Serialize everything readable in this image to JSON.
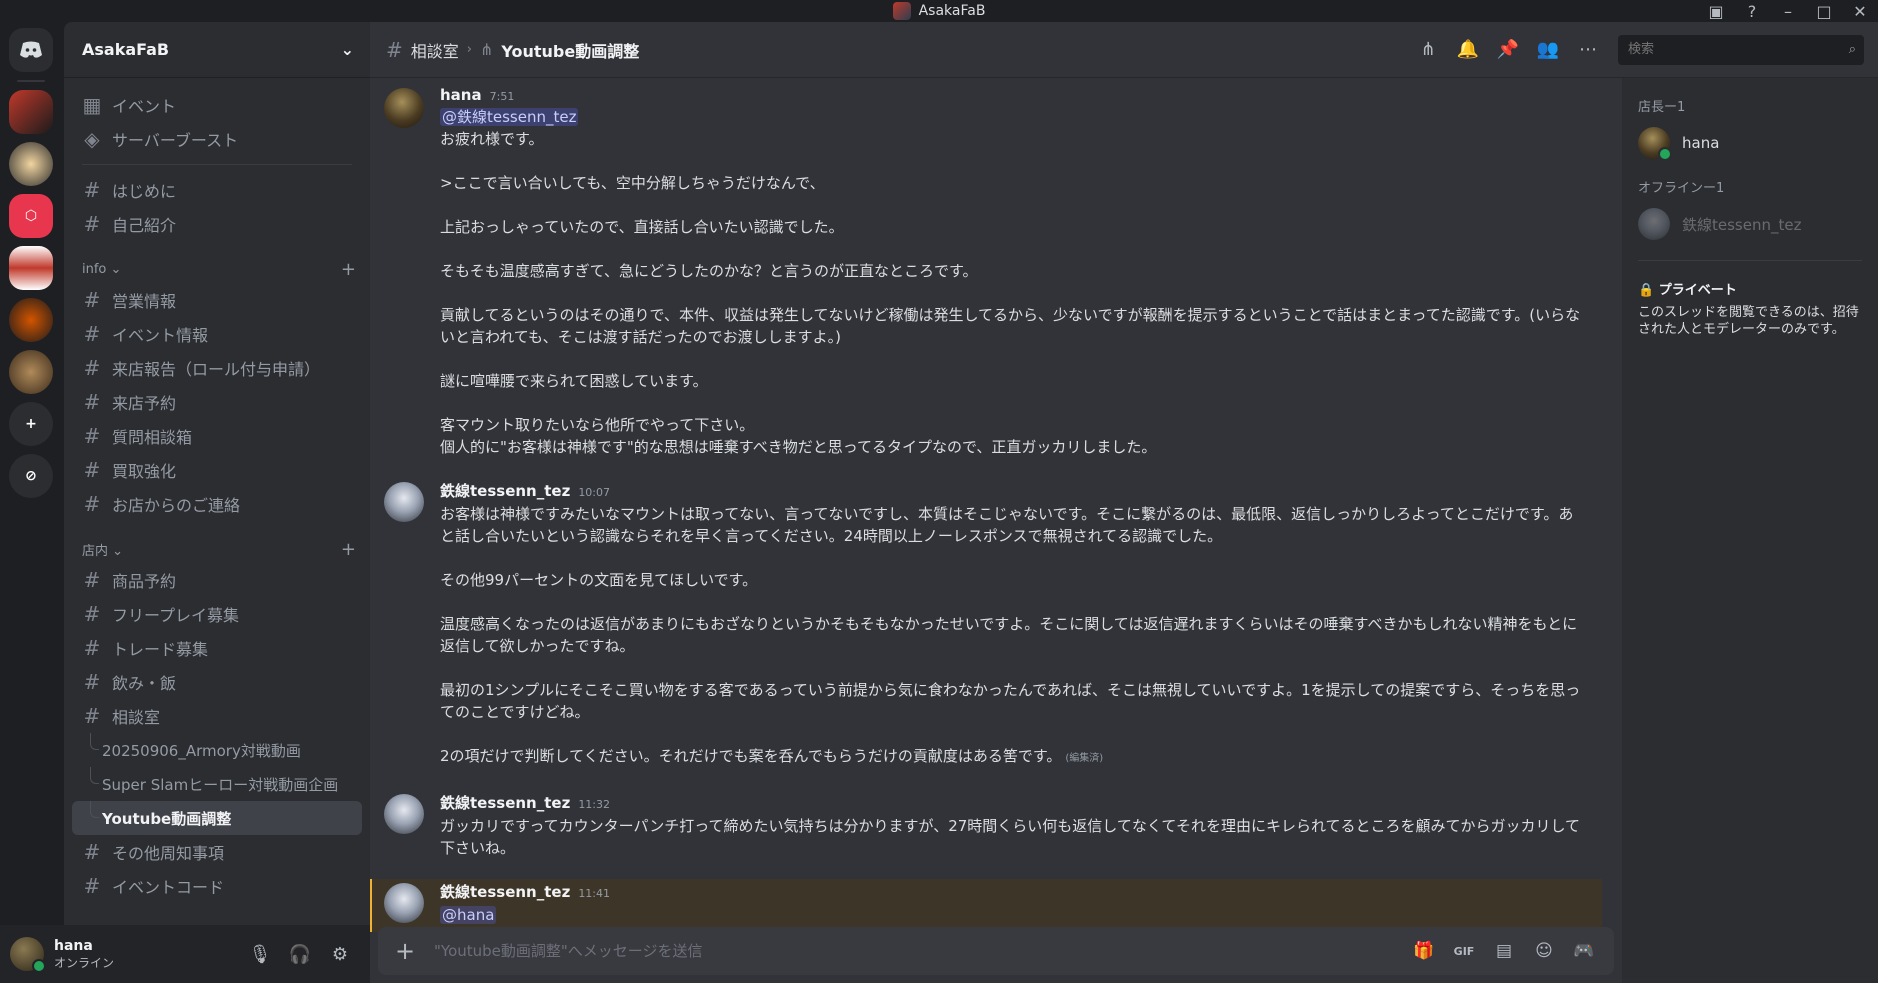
{
  "titlebar": {
    "title": "AsakaFaB"
  },
  "guild": {
    "name": "AsakaFaB"
  },
  "sidebar": {
    "top_items": [
      {
        "icon": "calendar-icon",
        "label": "イベント"
      },
      {
        "icon": "boost-icon",
        "label": "サーバーブースト"
      }
    ],
    "channels_general": [
      "はじめに",
      "自己紹介"
    ],
    "category_info": "info",
    "channels_info": [
      "営業情報",
      "イベント情報",
      "来店報告（ロール付与申請）",
      "来店予約",
      "質問相談箱",
      "買取強化",
      "お店からのご連絡"
    ],
    "category_store": "店内",
    "channels_store": [
      "商品予約",
      "フリープレイ募集",
      "トレード募集",
      "飲み・飯",
      "相談室"
    ],
    "threads": [
      "20250906_Armory対戦動画",
      "Super Slamヒーロー対戦動画企画",
      "Youtube動画調整"
    ],
    "channels_after": [
      "その他周知事項",
      "イベントコード"
    ]
  },
  "user": {
    "name": "hana",
    "status": "オンライン"
  },
  "topbar": {
    "channel": "相談室",
    "thread": "Youtube動画調整",
    "search_placeholder": "検索"
  },
  "messages": [
    {
      "author": "hana",
      "time": "7:51",
      "avatar": "hana",
      "mention": "@鉄線tessenn_tez",
      "lines": [
        "お疲れ様です。",
        "",
        ">ここで言い合いしても、空中分解しちゃうだけなんで、",
        "",
        "上記おっしゃっていたので、直接話し合いたい認識でした。",
        "",
        "そもそも温度感高すぎて、急にどうしたのかな？と言うのが正直なところです。",
        "",
        "貢献してるというのはその通りで、本件、収益は発生してないけど稼働は発生してるから、少ないですが報酬を提示するということで話はまとまってた認識です。(いらないと言われても、そこは渡す話だったのでお渡ししますよ。)",
        "",
        "謎に喧嘩腰で来られて困惑しています。",
        "",
        "客マウント取りたいなら他所でやって下さい。",
        "個人的に\"お客様は神様です\"的な思想は唾棄すべき物だと思ってるタイプなので、正直ガッカリしました。"
      ]
    },
    {
      "author": "鉄線tessenn_tez",
      "time": "10:07",
      "avatar": "tez",
      "lines": [
        "お客様は神様ですみたいなマウントは取ってない、言ってないですし、本質はそこじゃないです。そこに繋がるのは、最低限、返信しっかりしろよってとこだけです。あと話し合いたいという認識ならそれを早く言ってください。24時間以上ノーレスポンスで無視されてる認識でした。",
        "",
        "その他99パーセントの文面を見てほしいです。",
        "",
        "温度感高くなったのは返信があまりにもおざなりというかそもそもなかったせいですよ。そこに関しては返信遅れますくらいはその唾棄すべきかもしれない精神をもとに返信して欲しかったですね。",
        "",
        "最初の1シンプルにそこそこ買い物をする客であるっていう前提から気に食わなかったんであれば、そこは無視していいですよ。1を提示しての提案ですら、そっちを思ってのことですけどね。",
        "",
        "2の項だけで判断してください。それだけでも案を呑んでもらうだけの貢献度はある筈です。"
      ],
      "edited": "(編集済)"
    },
    {
      "author": "鉄線tessenn_tez",
      "time": "11:32",
      "avatar": "tez",
      "lines": [
        "ガッカリですってカウンターパンチ打って締めたい気持ちは分かりますが、27時間くらい何も返信してなくてそれを理由にキレられてるところを顧みてからガッカリして下さいね。"
      ]
    },
    {
      "author": "鉄線tessenn_tez",
      "time": "11:41",
      "avatar": "tez",
      "mention": "@hana",
      "lines": []
    }
  ],
  "composer": {
    "placeholder": "\"Youtube動画調整\"へメッセージを送信"
  },
  "members": {
    "owner_heading": "店長ー1",
    "owner": "hana",
    "offline_heading": "オフラインー1",
    "offline": "鉄線tessenn_tez",
    "private_title": "プライベート",
    "private_text": "このスレッドを閲覧できるのは、招待された人とモデレーターのみです。"
  }
}
